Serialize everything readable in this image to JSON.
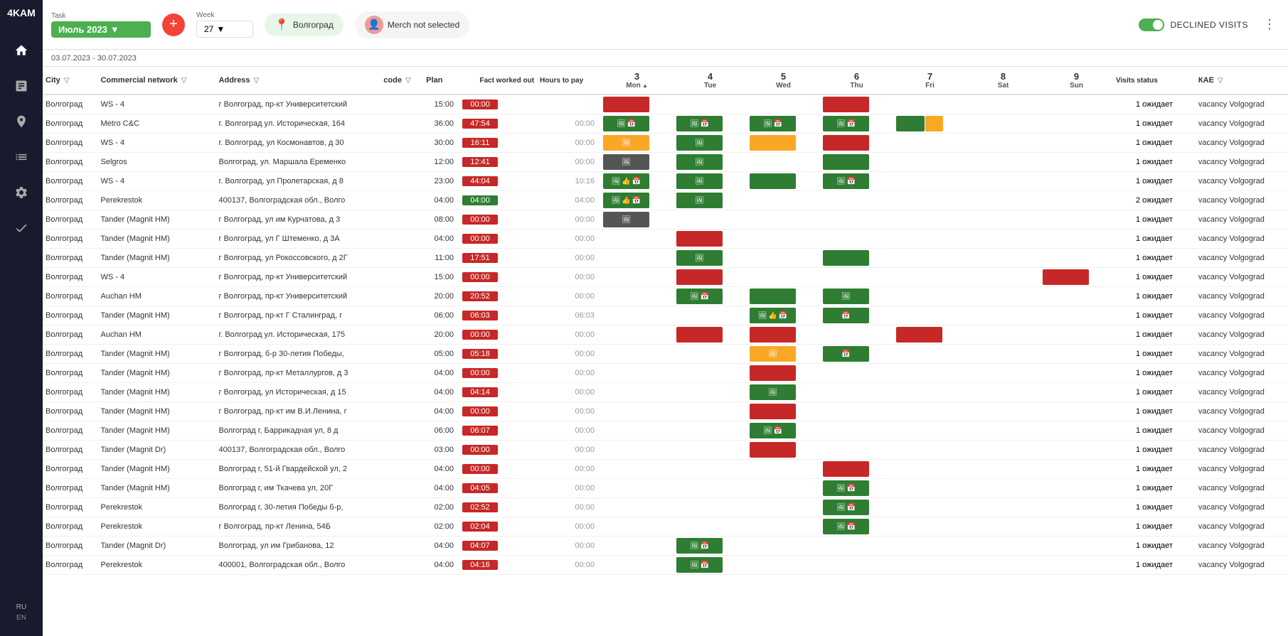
{
  "app": {
    "name": "4KAM",
    "lang": "RU",
    "lang_en": "EN"
  },
  "topbar": {
    "task_label": "Task",
    "task_value": "Июль 2023",
    "week_label": "Week",
    "week_value": "27",
    "location": "Волгоград",
    "merch": "Merch not selected",
    "declined_label": "DECLINED VISITS",
    "more_label": "⋮",
    "date_range": "03.07.2023 - 30.07.2023"
  },
  "table": {
    "columns": {
      "city": "City",
      "network": "Commercial network",
      "address": "Address",
      "code": "code",
      "plan": "Plan",
      "fact": "Fact worked out",
      "hours": "Hours to pay",
      "d3": "3",
      "d3_day": "Mon",
      "d4": "4",
      "d4_day": "Tue",
      "d5": "5",
      "d5_day": "Wed",
      "d6": "6",
      "d6_day": "Thu",
      "d7": "7",
      "d7_day": "Fri",
      "d8": "8",
      "d8_day": "Sat",
      "d9": "9",
      "d9_day": "Sun",
      "visits": "Visits status",
      "kae": "КАЕ"
    },
    "rows": [
      {
        "city": "Волгоград",
        "network": "WS - 4",
        "address": "г Волгоград, пр-кт Университетский",
        "plan": "15:00",
        "fact": "00:00",
        "fact_color": "red",
        "hours": "",
        "d3": "red",
        "d4": "",
        "d5": "",
        "d6": "red",
        "d7": "",
        "d8": "",
        "d9": "",
        "visits": "1 ожидает",
        "kae": "vacancy Volgograd"
      },
      {
        "city": "Волгоград",
        "network": "Metro C&C",
        "address": "г. Волгоград ул. Историческая, 164",
        "plan": "36:00",
        "fact": "47:54",
        "fact_color": "red",
        "hours": "00:00",
        "d3": "green-icons",
        "d4": "green-icons",
        "d5": "green-icons",
        "d6": "green-icons",
        "d7": "green-yellow",
        "d8": "",
        "d9": "",
        "visits": "1 ожидает",
        "kae": "vacancy Volgograd"
      },
      {
        "city": "Волгоград",
        "network": "WS - 4",
        "address": "г. Волгоград, ул Космонавтов, д 30",
        "plan": "30:00",
        "fact": "16:11",
        "fact_color": "red",
        "hours": "00:00",
        "d3": "yellow-icon",
        "d4": "green-icon",
        "d5": "yellow",
        "d6": "red",
        "d7": "",
        "d8": "",
        "d9": "",
        "visits": "1 ожидает",
        "kae": "vacancy Volgograd"
      },
      {
        "city": "Волгоград",
        "network": "Selgros",
        "address": "Волгоград, ул. Маршала Еременко",
        "plan": "12:00",
        "fact": "12:41",
        "fact_color": "red",
        "hours": "00:00",
        "d3": "icon",
        "d4": "green-icon",
        "d5": "",
        "d6": "green",
        "d7": "",
        "d8": "",
        "d9": "",
        "visits": "1 ожидает",
        "kae": "vacancy Volgograd"
      },
      {
        "city": "Волгоград",
        "network": "WS - 4",
        "address": "г. Волгоград, ул Пролетарская, д 8",
        "plan": "23:00",
        "fact": "44:04",
        "fact_color": "red",
        "hours": "10:16",
        "d3": "icons-like",
        "d4": "green-icon",
        "d5": "green",
        "d6": "green-icons",
        "d7": "",
        "d8": "",
        "d9": "",
        "visits": "1 ожидает",
        "kae": "vacancy Volgograd"
      },
      {
        "city": "Волгоград",
        "network": "Perekrestok",
        "address": "400137, Волгоградская обл., Волго",
        "plan": "04:00",
        "fact": "04:00",
        "fact_color": "green",
        "hours": "04:00",
        "d3": "icons-like",
        "d4": "green-icon",
        "d5": "",
        "d6": "",
        "d7": "",
        "d8": "",
        "d9": "",
        "visits": "2 ожидает",
        "kae": "vacancy Volgograd"
      },
      {
        "city": "Волгоград",
        "network": "Tander (Magnit HM)",
        "address": "г Волгоград, ул им Курчатова, д 3",
        "plan": "08:00",
        "fact": "00:00",
        "fact_color": "red",
        "hours": "00:00",
        "d3": "icon",
        "d4": "",
        "d5": "",
        "d6": "",
        "d7": "",
        "d8": "",
        "d9": "",
        "visits": "1 ожидает",
        "kae": "vacancy Volgograd"
      },
      {
        "city": "Волгоград",
        "network": "Tander (Magnit HM)",
        "address": "г Волгоград, ул Г Штеменко, д 3А",
        "plan": "04:00",
        "fact": "00:00",
        "fact_color": "red",
        "hours": "00:00",
        "d3": "",
        "d4": "red",
        "d5": "",
        "d6": "",
        "d7": "",
        "d8": "",
        "d9": "",
        "visits": "1 ожидает",
        "kae": "vacancy Volgograd"
      },
      {
        "city": "Волгоград",
        "network": "Tander (Magnit HM)",
        "address": "г Волгоград, ул Рокоссовского, д 2Г",
        "plan": "11:00",
        "fact": "17:51",
        "fact_color": "red",
        "hours": "00:00",
        "d3": "",
        "d4": "green-icon",
        "d5": "",
        "d6": "green",
        "d7": "",
        "d8": "",
        "d9": "",
        "visits": "1 ожидает",
        "kae": "vacancy Volgograd"
      },
      {
        "city": "Волгоград",
        "network": "WS - 4",
        "address": "г Волгоград, пр-кт Университетский",
        "plan": "15:00",
        "fact": "00:00",
        "fact_color": "red",
        "hours": "00:00",
        "d3": "",
        "d4": "red",
        "d5": "",
        "d6": "",
        "d7": "",
        "d8": "",
        "d9": "red-long",
        "visits": "1 ожидает",
        "kae": "vacancy Volgograd"
      },
      {
        "city": "Волгоград",
        "network": "Auchan HM",
        "address": "г Волгоград, пр-кт Университетский",
        "plan": "20:00",
        "fact": "20:52",
        "fact_color": "red",
        "hours": "00:00",
        "d3": "",
        "d4": "green-icon-cal",
        "d5": "green",
        "d6": "green-icon",
        "d7": "",
        "d8": "",
        "d9": "",
        "visits": "1 ожидает",
        "kae": "vacancy Volgograd"
      },
      {
        "city": "Волгоград",
        "network": "Tander (Magnit HM)",
        "address": "г Волгоград, пр-кт Г Сталинград, г",
        "plan": "06:00",
        "fact": "06:03",
        "fact_color": "red",
        "hours": "06:03",
        "d3": "",
        "d4": "",
        "d5": "green-like",
        "d6": "green-cal",
        "d7": "",
        "d8": "",
        "d9": "",
        "visits": "1 ожидает",
        "kae": "vacancy Volgograd"
      },
      {
        "city": "Волгоград",
        "network": "Auchan HM",
        "address": "г. Волгоград ул. Историческая, 175",
        "plan": "20:00",
        "fact": "00:00",
        "fact_color": "red",
        "hours": "00:00",
        "d3": "",
        "d4": "red",
        "d5": "red",
        "d6": "",
        "d7": "red-long",
        "d8": "",
        "d9": "",
        "visits": "1 ожидает",
        "kae": "vacancy Volgograd"
      },
      {
        "city": "Волгоград",
        "network": "Tander (Magnit HM)",
        "address": "г Волгоград, б-р 30-летия Победы,",
        "plan": "05:00",
        "fact": "05:18",
        "fact_color": "red",
        "hours": "00:00",
        "d3": "",
        "d4": "",
        "d5": "yellow-icon",
        "d6": "green-cal",
        "d7": "",
        "d8": "",
        "d9": "",
        "visits": "1 ожидает",
        "kae": "vacancy Volgograd"
      },
      {
        "city": "Волгоград",
        "network": "Tander (Magnit HM)",
        "address": "г Волгоград, пр-кт Металлургов, д 3",
        "plan": "04:00",
        "fact": "00:00",
        "fact_color": "red",
        "hours": "00:00",
        "d3": "",
        "d4": "",
        "d5": "red",
        "d6": "",
        "d7": "",
        "d8": "",
        "d9": "",
        "visits": "1 ожидает",
        "kae": "vacancy Volgograd"
      },
      {
        "city": "Волгоград",
        "network": "Tander (Magnit HM)",
        "address": "г Волгоград, ул Историческая, д 15",
        "plan": "04:00",
        "fact": "04:14",
        "fact_color": "red",
        "hours": "00:00",
        "d3": "",
        "d4": "",
        "d5": "green-icon",
        "d6": "",
        "d7": "",
        "d8": "",
        "d9": "",
        "visits": "1 ожидает",
        "kae": "vacancy Volgograd"
      },
      {
        "city": "Волгоград",
        "network": "Tander (Magnit HM)",
        "address": "г Волгоград, пр-кт им В.И.Ленина, г",
        "plan": "04:00",
        "fact": "00:00",
        "fact_color": "red",
        "hours": "00:00",
        "d3": "",
        "d4": "",
        "d5": "red",
        "d6": "",
        "d7": "",
        "d8": "",
        "d9": "",
        "visits": "1 ожидает",
        "kae": "vacancy Volgograd"
      },
      {
        "city": "Волгоград",
        "network": "Tander (Magnit HM)",
        "address": "Волгоград г, Баррикадная ул, 8 д",
        "plan": "06:00",
        "fact": "06:07",
        "fact_color": "red",
        "hours": "00:00",
        "d3": "",
        "d4": "",
        "d5": "green-icon-cal",
        "d6": "",
        "d7": "",
        "d8": "",
        "d9": "",
        "visits": "1 ожидает",
        "kae": "vacancy Volgograd"
      },
      {
        "city": "Волгоград",
        "network": "Tander (Magnit Dr)",
        "address": "400137, Волгоградская обл., Волго",
        "plan": "03:00",
        "fact": "00:00",
        "fact_color": "red",
        "hours": "00:00",
        "d3": "",
        "d4": "",
        "d5": "red",
        "d6": "",
        "d7": "",
        "d8": "",
        "d9": "",
        "visits": "1 ожидает",
        "kae": "vacancy Volgograd"
      },
      {
        "city": "Волгоград",
        "network": "Tander (Magnit HM)",
        "address": "Волгоград г, 51-й Гвардейской ул, 2",
        "plan": "04:00",
        "fact": "00:00",
        "fact_color": "red",
        "hours": "00:00",
        "d3": "",
        "d4": "",
        "d5": "",
        "d6": "red",
        "d7": "",
        "d8": "",
        "d9": "",
        "visits": "1 ожидает",
        "kae": "vacancy Volgograd"
      },
      {
        "city": "Волгоград",
        "network": "Tander (Magnit HM)",
        "address": "Волгоград г, им Ткачева ул, 20Г",
        "plan": "04:00",
        "fact": "04:05",
        "fact_color": "red",
        "hours": "00:00",
        "d3": "",
        "d4": "",
        "d5": "",
        "d6": "green-icon-cal",
        "d7": "",
        "d8": "",
        "d9": "",
        "visits": "1 ожидает",
        "kae": "vacancy Volgograd"
      },
      {
        "city": "Волгоград",
        "network": "Perekrestok",
        "address": "Волгоград г, 30-летия Победы б-р,",
        "plan": "02:00",
        "fact": "02:52",
        "fact_color": "red",
        "hours": "00:00",
        "d3": "",
        "d4": "",
        "d5": "",
        "d6": "green-icon-cal",
        "d7": "",
        "d8": "",
        "d9": "",
        "visits": "1 ожидает",
        "kae": "vacancy Volgograd"
      },
      {
        "city": "Волгоград",
        "network": "Perekrestok",
        "address": "г Волгоград, пр-кт Ленина, 54Б",
        "plan": "02:00",
        "fact": "02:04",
        "fact_color": "red",
        "hours": "00:00",
        "d3": "",
        "d4": "",
        "d5": "",
        "d6": "green-icon-cal",
        "d7": "",
        "d8": "",
        "d9": "",
        "visits": "1 ожидает",
        "kae": "vacancy Volgograd"
      },
      {
        "city": "Волгоград",
        "network": "Tander (Magnit Dr)",
        "address": "Волгоград, ул им Грибанова, 12",
        "plan": "04:00",
        "fact": "04:07",
        "fact_color": "red",
        "hours": "00:00",
        "d3": "",
        "d4": "green-icon-cal",
        "d5": "",
        "d6": "",
        "d7": "",
        "d8": "",
        "d9": "",
        "visits": "1 ожидает",
        "kae": "vacancy Volgograd"
      },
      {
        "city": "Волгоград",
        "network": "Perekrestok",
        "address": "400001, Волгоградская обл., Волго",
        "plan": "04:00",
        "fact": "04:16",
        "fact_color": "red",
        "hours": "00:00",
        "d3": "",
        "d4": "green-icon-cal",
        "d5": "",
        "d6": "",
        "d7": "",
        "d8": "",
        "d9": "",
        "visits": "1 ожидает",
        "kae": "vacancy Volgograd"
      }
    ]
  }
}
